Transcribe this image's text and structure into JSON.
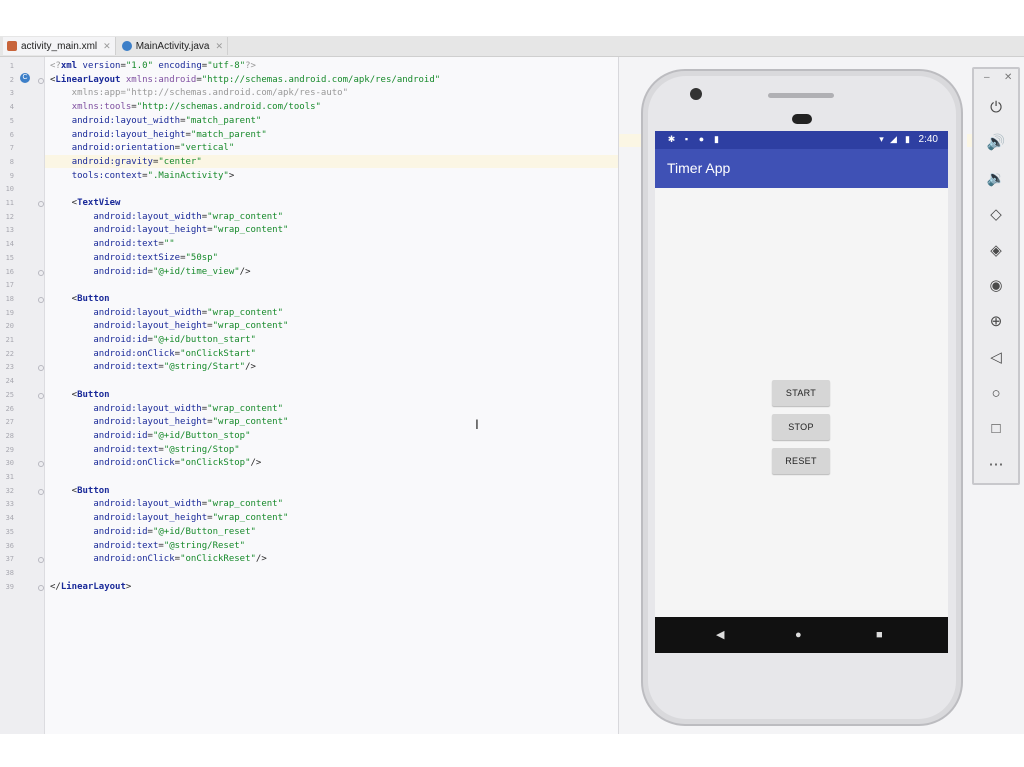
{
  "tabs": [
    {
      "label": "activity_main.xml",
      "active": true,
      "icon": "xml-file-icon"
    },
    {
      "label": "MainActivity.java",
      "active": false,
      "icon": "java-class-icon"
    }
  ],
  "editor": {
    "line_numbers": [
      "1",
      "2",
      "3",
      "4",
      "5",
      "6",
      "7",
      "8",
      "9",
      "10",
      "11",
      "12",
      "13",
      "14",
      "15",
      "16",
      "17",
      "18",
      "19",
      "20",
      "21",
      "22",
      "23",
      "24",
      "25",
      "26",
      "27",
      "28",
      "29",
      "30",
      "31",
      "32",
      "33",
      "34",
      "35",
      "36",
      "37",
      "38",
      "39"
    ],
    "lines": [
      {
        "parts": [
          [
            "gray",
            "<?"
          ],
          [
            "tag",
            "xml "
          ],
          [
            "attr",
            "version"
          ],
          [
            "",
            "="
          ],
          [
            "str",
            "\"1.0\" "
          ],
          [
            "attr",
            "encoding"
          ],
          [
            "",
            "="
          ],
          [
            "str",
            "\"utf-8\""
          ],
          [
            "gray",
            "?>"
          ]
        ]
      },
      {
        "parts": [
          [
            "",
            "<"
          ],
          [
            "tag",
            "LinearLayout "
          ],
          [
            "ns",
            "xmlns:android"
          ],
          [
            "",
            "="
          ],
          [
            "str",
            "\"http://schemas.android.com/apk/res/android\""
          ]
        ]
      },
      {
        "parts": [
          [
            "gray",
            "    xmlns:app=\"http://schemas.android.com/apk/res-auto\""
          ]
        ]
      },
      {
        "parts": [
          [
            "",
            "    "
          ],
          [
            "ns",
            "xmlns:tools"
          ],
          [
            "",
            "="
          ],
          [
            "str",
            "\"http://schemas.android.com/tools\""
          ]
        ]
      },
      {
        "parts": [
          [
            "",
            "    "
          ],
          [
            "attr",
            "android:layout_width"
          ],
          [
            "",
            "="
          ],
          [
            "str",
            "\"match_parent\""
          ]
        ]
      },
      {
        "parts": [
          [
            "",
            "    "
          ],
          [
            "attr",
            "android:layout_height"
          ],
          [
            "",
            "="
          ],
          [
            "str",
            "\"match_parent\""
          ]
        ]
      },
      {
        "parts": [
          [
            "",
            "    "
          ],
          [
            "attr",
            "android:orientation"
          ],
          [
            "",
            "="
          ],
          [
            "str",
            "\"vertical\""
          ]
        ]
      },
      {
        "parts": [
          [
            "",
            "    "
          ],
          [
            "attr",
            "android:gravity"
          ],
          [
            "",
            "="
          ],
          [
            "str",
            "\"center\""
          ]
        ]
      },
      {
        "parts": [
          [
            "",
            "    "
          ],
          [
            "attr",
            "tools:context"
          ],
          [
            "",
            "="
          ],
          [
            "str",
            "\".MainActivity\""
          ],
          [
            "",
            ">"
          ]
        ]
      },
      {
        "parts": [
          [
            "",
            ""
          ]
        ]
      },
      {
        "parts": [
          [
            "",
            "    <"
          ],
          [
            "tag",
            "TextView"
          ]
        ]
      },
      {
        "parts": [
          [
            "",
            "        "
          ],
          [
            "attr",
            "android:layout_width"
          ],
          [
            "",
            "="
          ],
          [
            "str",
            "\"wrap_content\""
          ]
        ]
      },
      {
        "parts": [
          [
            "",
            "        "
          ],
          [
            "attr",
            "android:layout_height"
          ],
          [
            "",
            "="
          ],
          [
            "str",
            "\"wrap_content\""
          ]
        ]
      },
      {
        "parts": [
          [
            "",
            "        "
          ],
          [
            "attr",
            "android:text"
          ],
          [
            "",
            "="
          ],
          [
            "str",
            "\"\""
          ]
        ]
      },
      {
        "parts": [
          [
            "",
            "        "
          ],
          [
            "attr",
            "android:textSize"
          ],
          [
            "",
            "="
          ],
          [
            "str",
            "\"50sp\""
          ]
        ]
      },
      {
        "parts": [
          [
            "",
            "        "
          ],
          [
            "attr",
            "android:id"
          ],
          [
            "",
            "="
          ],
          [
            "str",
            "\"@+id/time_view\""
          ],
          [
            "",
            "/>"
          ]
        ]
      },
      {
        "parts": [
          [
            "",
            ""
          ]
        ]
      },
      {
        "parts": [
          [
            "",
            "    <"
          ],
          [
            "tag",
            "Button"
          ]
        ]
      },
      {
        "parts": [
          [
            "",
            "        "
          ],
          [
            "attr",
            "android:layout_width"
          ],
          [
            "",
            "="
          ],
          [
            "str",
            "\"wrap_content\""
          ]
        ]
      },
      {
        "parts": [
          [
            "",
            "        "
          ],
          [
            "attr",
            "android:layout_height"
          ],
          [
            "",
            "="
          ],
          [
            "str",
            "\"wrap_content\""
          ]
        ]
      },
      {
        "parts": [
          [
            "",
            "        "
          ],
          [
            "attr",
            "android:id"
          ],
          [
            "",
            "="
          ],
          [
            "str",
            "\"@+id/button_start\""
          ]
        ]
      },
      {
        "parts": [
          [
            "",
            "        "
          ],
          [
            "attr",
            "android:onClick"
          ],
          [
            "",
            "="
          ],
          [
            "str",
            "\"onClickStart\""
          ]
        ]
      },
      {
        "parts": [
          [
            "",
            "        "
          ],
          [
            "attr",
            "android:text"
          ],
          [
            "",
            "="
          ],
          [
            "str",
            "\"@string/Start\""
          ],
          [
            "",
            "/>"
          ]
        ]
      },
      {
        "parts": [
          [
            "",
            ""
          ]
        ]
      },
      {
        "parts": [
          [
            "",
            "    <"
          ],
          [
            "tag",
            "Button"
          ]
        ]
      },
      {
        "parts": [
          [
            "",
            "        "
          ],
          [
            "attr",
            "android:layout_width"
          ],
          [
            "",
            "="
          ],
          [
            "str",
            "\"wrap_content\""
          ]
        ]
      },
      {
        "parts": [
          [
            "",
            "        "
          ],
          [
            "attr",
            "android:layout_height"
          ],
          [
            "",
            "="
          ],
          [
            "str",
            "\"wrap_content\""
          ]
        ]
      },
      {
        "parts": [
          [
            "",
            "        "
          ],
          [
            "attr",
            "android:id"
          ],
          [
            "",
            "="
          ],
          [
            "str",
            "\"@+id/Button_stop\""
          ]
        ]
      },
      {
        "parts": [
          [
            "",
            "        "
          ],
          [
            "attr",
            "android:text"
          ],
          [
            "",
            "="
          ],
          [
            "str",
            "\"@string/Stop\""
          ]
        ]
      },
      {
        "parts": [
          [
            "",
            "        "
          ],
          [
            "attr",
            "android:onClick"
          ],
          [
            "",
            "="
          ],
          [
            "str",
            "\"onClickStop\""
          ],
          [
            "",
            "/>"
          ]
        ]
      },
      {
        "parts": [
          [
            "",
            ""
          ]
        ]
      },
      {
        "parts": [
          [
            "",
            "    <"
          ],
          [
            "tag",
            "Button"
          ]
        ]
      },
      {
        "parts": [
          [
            "",
            "        "
          ],
          [
            "attr",
            "android:layout_width"
          ],
          [
            "",
            "="
          ],
          [
            "str",
            "\"wrap_content\""
          ]
        ]
      },
      {
        "parts": [
          [
            "",
            "        "
          ],
          [
            "attr",
            "android:layout_height"
          ],
          [
            "",
            "="
          ],
          [
            "str",
            "\"wrap_content\""
          ]
        ]
      },
      {
        "parts": [
          [
            "",
            "        "
          ],
          [
            "attr",
            "android:id"
          ],
          [
            "",
            "="
          ],
          [
            "str",
            "\"@+id/Button_reset\""
          ]
        ]
      },
      {
        "parts": [
          [
            "",
            "        "
          ],
          [
            "attr",
            "android:text"
          ],
          [
            "",
            "="
          ],
          [
            "str",
            "\"@string/Reset\""
          ]
        ]
      },
      {
        "parts": [
          [
            "",
            "        "
          ],
          [
            "attr",
            "android:onClick"
          ],
          [
            "",
            "="
          ],
          [
            "str",
            "\"onClickReset\""
          ],
          [
            "",
            "/>"
          ]
        ]
      },
      {
        "parts": [
          [
            "",
            ""
          ]
        ]
      },
      {
        "parts": [
          [
            "",
            "</"
          ],
          [
            "tag",
            "LinearLayout"
          ],
          [
            "",
            ">"
          ]
        ]
      }
    ]
  },
  "phone": {
    "status_time": "2:40",
    "app_title": "Timer App",
    "buttons": {
      "start": "START",
      "stop": "STOP",
      "reset": "RESET"
    },
    "nav_icons": [
      "back-icon",
      "home-icon",
      "recents-icon"
    ]
  },
  "emulator_tools": [
    "power-icon",
    "volume-up-icon",
    "volume-down-icon",
    "rotate-left-icon",
    "rotate-right-icon",
    "camera-icon",
    "zoom-icon",
    "back-icon",
    "home-icon",
    "overview-icon",
    "more-icon"
  ],
  "colors": {
    "app_bar": "#3f51b5",
    "status_bar": "#2e3fa2",
    "xml_tag": "#1a2a99",
    "xml_string": "#178a2b"
  }
}
